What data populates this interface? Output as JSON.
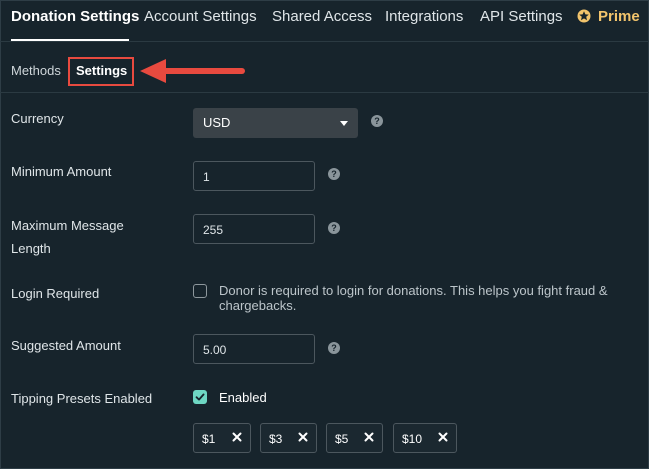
{
  "topnav": {
    "tabs": [
      {
        "label": "Donation Settings"
      },
      {
        "label": "Account Settings"
      },
      {
        "label": "Shared Access"
      },
      {
        "label": "Integrations"
      },
      {
        "label": "API Settings"
      },
      {
        "label": "Prime"
      }
    ],
    "prime_icon": "prime-gear-icon"
  },
  "subnav": {
    "methods": "Methods",
    "settings": "Settings"
  },
  "form": {
    "currency": {
      "label": "Currency",
      "value": "USD"
    },
    "minimum_amount": {
      "label": "Minimum Amount",
      "value": "1"
    },
    "max_message": {
      "label_line1": "Maximum Message",
      "label_line2": "Length",
      "value": "255"
    },
    "login_required": {
      "label": "Login Required",
      "text_line1": "Donor is required to login for donations. This helps you fight fraud &",
      "text_line2": "chargebacks.",
      "checked": false
    },
    "suggested_amount": {
      "label": "Suggested Amount",
      "value": "5.00"
    },
    "tipping_presets": {
      "label": "Tipping Presets Enabled",
      "checkbox_label": "Enabled",
      "checked": true
    },
    "presets": [
      "$1",
      "$3",
      "$5",
      "$10"
    ],
    "help_glyph": "?"
  },
  "colors": {
    "background": "#17242c",
    "accent_red": "#e84a3f",
    "prime": "#f2c46c",
    "check": "#6ed7c3"
  }
}
